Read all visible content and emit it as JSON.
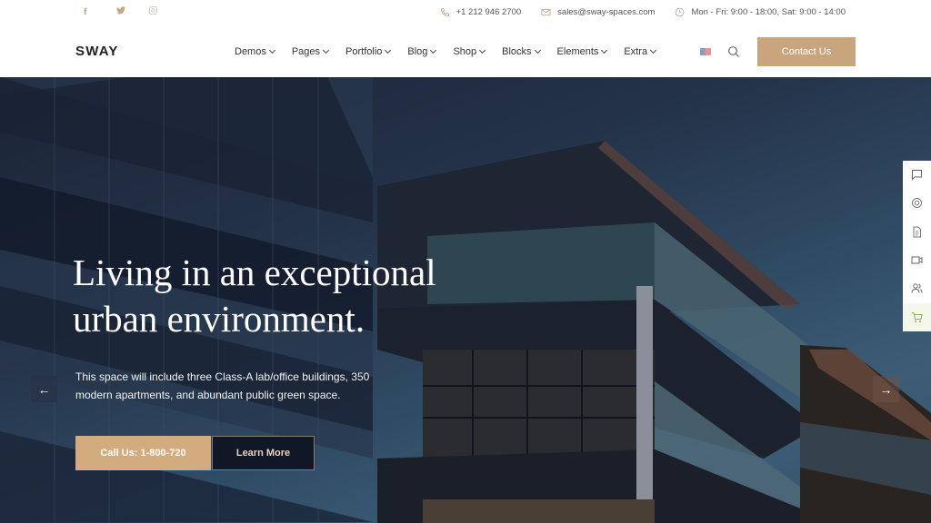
{
  "topbar": {
    "social": [
      {
        "name": "facebook",
        "glyph": "f"
      },
      {
        "name": "twitter",
        "glyph": "🐦"
      },
      {
        "name": "instagram",
        "glyph": "◎"
      }
    ],
    "phone": "+1 212 946 2700",
    "email": "sales@sway-spaces.com",
    "hours": "Mon - Fri: 9:00 - 18:00, Sat: 9:00 - 14:00"
  },
  "header": {
    "logo": "SWAY",
    "nav": [
      {
        "label": "Demos"
      },
      {
        "label": "Pages"
      },
      {
        "label": "Portfolio"
      },
      {
        "label": "Blog"
      },
      {
        "label": "Shop"
      },
      {
        "label": "Blocks"
      },
      {
        "label": "Elements"
      },
      {
        "label": "Extra"
      }
    ],
    "language": "en-US",
    "contact_button": "Contact Us"
  },
  "hero": {
    "title_line1": "Living in an exceptional",
    "title_line2": "urban environment.",
    "description": "This space will include three Class-A lab/office buildings, 350 modern apartments, and abundant public green space.",
    "call_button": "Call Us: 1-800-720",
    "learn_button": "Learn More",
    "prev_arrow": "←",
    "next_arrow": "→"
  },
  "side_tools": [
    {
      "name": "chat"
    },
    {
      "name": "support"
    },
    {
      "name": "document"
    },
    {
      "name": "video"
    },
    {
      "name": "users"
    },
    {
      "name": "cart"
    }
  ],
  "colors": {
    "accent": "#c9a57e",
    "dark": "#101828"
  }
}
